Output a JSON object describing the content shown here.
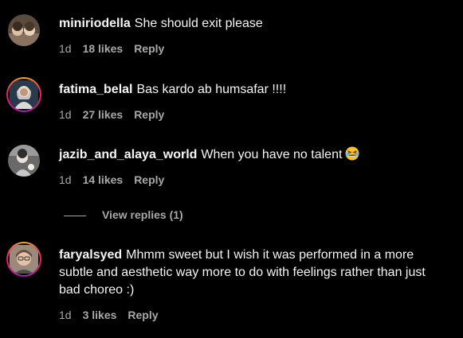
{
  "comments": [
    {
      "username": "miniriodella",
      "text": "She should exit please",
      "age": "1d",
      "likes": "18 likes",
      "reply": "Reply"
    },
    {
      "username": "fatima_belal",
      "text": "Bas kardo ab humsafar !!!!",
      "age": "1d",
      "likes": "27 likes",
      "reply": "Reply"
    },
    {
      "username": "jazib_and_alaya_world",
      "text": "When you have no talent",
      "emoji": "laughing-crying-emoji",
      "age": "1d",
      "likes": "14 likes",
      "reply": "Reply"
    },
    {
      "username": "faryalsyed",
      "text": "Mhmm sweet but I wish it was performed in a more subtle and aesthetic way more to do with feelings rather than just bad choreo :)",
      "age": "1d",
      "likes": "3 likes",
      "reply": "Reply"
    }
  ],
  "view_replies_label": "View replies (1)",
  "colors": {
    "background": "#000000",
    "text": "#f5f5f5",
    "meta": "#a8a8a8",
    "story_ring": "#e91e63"
  }
}
